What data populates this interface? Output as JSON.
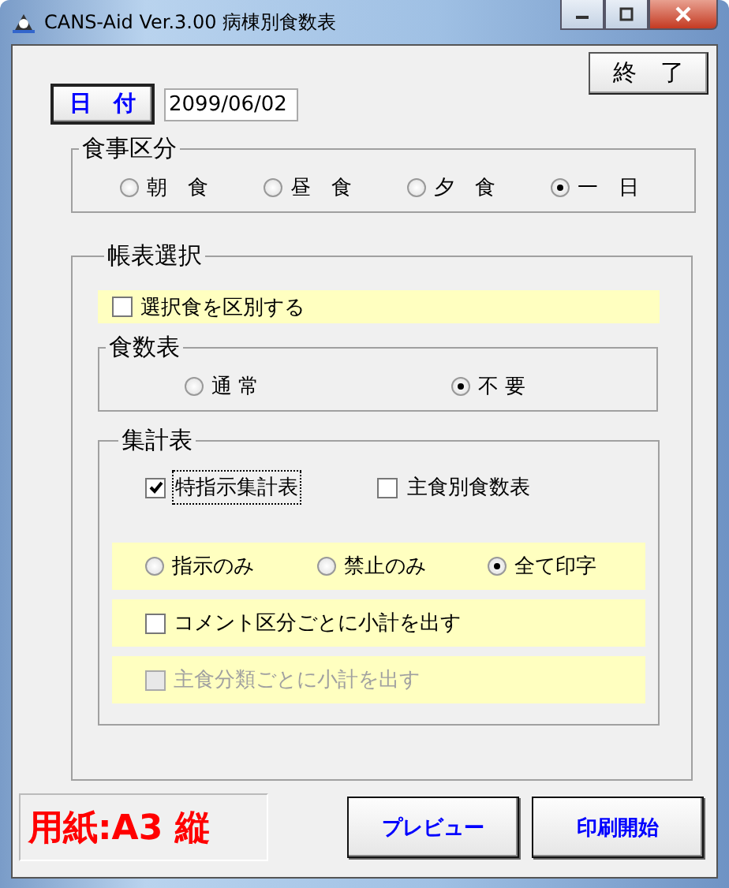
{
  "window": {
    "title": "CANS-Aid Ver.3.00 病棟別食数表"
  },
  "close_button": "終　了",
  "date": {
    "button": "日　付",
    "value": "2099/06/02"
  },
  "meal_group": {
    "legend": "食事区分",
    "options": [
      {
        "label": "朝　食",
        "selected": false
      },
      {
        "label": "昼　食",
        "selected": false
      },
      {
        "label": "夕　食",
        "selected": false
      },
      {
        "label": "一　日",
        "selected": true
      }
    ]
  },
  "report_group": {
    "legend": "帳表選択",
    "distinguish": {
      "label": "選択食を区別する",
      "checked": false
    },
    "count_table": {
      "legend": "食数表",
      "options": [
        {
          "label": "通 常",
          "selected": false
        },
        {
          "label": "不 要",
          "selected": true
        }
      ]
    },
    "summary_table": {
      "legend": "集計表",
      "checks": [
        {
          "label": "特指示集計表",
          "checked": true,
          "focused": true
        },
        {
          "label": "主食別食数表",
          "checked": false,
          "focused": false
        }
      ],
      "print_options": [
        {
          "label": "指示のみ",
          "selected": false
        },
        {
          "label": "禁止のみ",
          "selected": false
        },
        {
          "label": "全て印字",
          "selected": true
        }
      ],
      "subtotals": [
        {
          "label": "コメント区分ごとに小計を出す",
          "checked": false,
          "disabled": false
        },
        {
          "label": "主食分類ごとに小計を出す",
          "checked": false,
          "disabled": true
        }
      ]
    }
  },
  "paper": "用紙:A3 縦",
  "buttons": [
    {
      "label": "プレビュー"
    },
    {
      "label": "印刷開始"
    }
  ]
}
